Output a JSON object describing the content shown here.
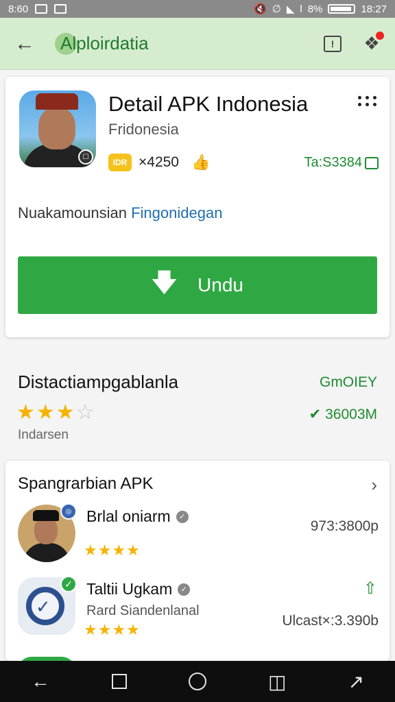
{
  "status_bar": {
    "time_left": "8:60",
    "time_right": "18:27",
    "battery_text": "8%",
    "signal_text": "l"
  },
  "app_bar": {
    "title": "Alploirdatia",
    "back_icon": "arrow-left-icon",
    "action1_icon": "square-info-icon",
    "action2_icon": "pin-icon"
  },
  "app_detail": {
    "name": "Detail APK Indonesia",
    "developer": "Fridonesia",
    "coin_label": "IDR",
    "count": "×4250",
    "right_meta": "Ta:S3384",
    "description_prefix": "Nuakamounsian",
    "description_link": "Fingonidegan",
    "download_label": "Undu",
    "download_icon": "arrow-down-icon"
  },
  "rating": {
    "title": "Distactiampgablanla",
    "stars_full": "★★★",
    "stars_half": "☆",
    "sublabel": "Indarsen",
    "right_top": "GmOIEY",
    "right_bottom": "✔ 36003M"
  },
  "related": {
    "title": "Spangrarbian APK",
    "items": [
      {
        "name": "Brlal oniarm",
        "sub": "",
        "stars": "★★★★",
        "value": "973:3800p"
      },
      {
        "name": "Taltii Ugkam",
        "sub": "Rard Siandenlanal",
        "stars": "★★★★",
        "value": "Ulcast×:3.390b"
      }
    ]
  },
  "nav_bar": {
    "back_icon": "back-triangle-icon",
    "recents_icon": "square-icon",
    "home_icon": "circle-icon",
    "bookmark_icon": "bookmark-icon",
    "share_icon": "share-icon"
  },
  "colors": {
    "accent_green": "#2fa844",
    "app_bar_bg": "#d6eccf",
    "star": "#f5b301",
    "link_blue": "#1f6fb0"
  }
}
